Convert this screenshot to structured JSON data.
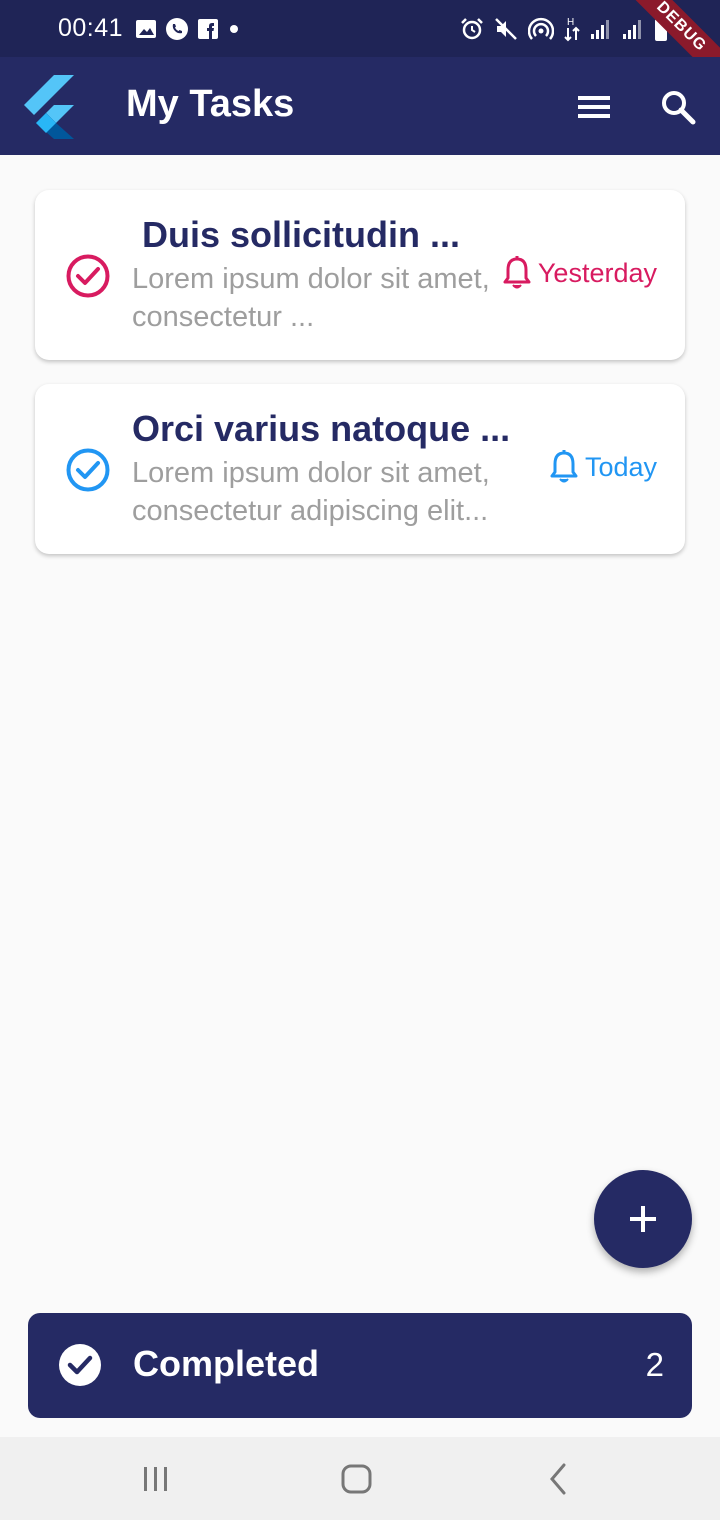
{
  "status_bar": {
    "time": "00:41",
    "left_icons": [
      "image-icon",
      "whatsapp-icon",
      "facebook-icon",
      "dot-icon"
    ],
    "right_icons": [
      "alarm-icon",
      "mute-icon",
      "hotspot-icon",
      "data-arrows-icon",
      "signal-icon",
      "signal-icon",
      "battery-icon"
    ],
    "network_label": "H",
    "debug_banner": "DEBUG"
  },
  "app_bar": {
    "title": "My Tasks",
    "logo": "flutter-logo",
    "actions": [
      "menu-icon",
      "search-icon"
    ]
  },
  "tasks": [
    {
      "title": "Duis sollicitudin ...",
      "description": "Lorem ipsum dolor sit amet, consectetur ...",
      "reminder": "Yesterday",
      "color": "#d81b60",
      "icon": "check-circle-outline-icon"
    },
    {
      "title": "Orci varius natoque ...",
      "description": "Lorem ipsum dolor sit amet, consectetur adipiscing elit...",
      "reminder": "Today",
      "color": "#2196f3",
      "icon": "check-circle-outline-icon"
    }
  ],
  "fab": {
    "icon": "plus-icon"
  },
  "completed": {
    "label": "Completed",
    "count": "2",
    "icon": "check-circle-icon"
  },
  "nav_bar": [
    "recents-icon",
    "home-icon",
    "back-icon"
  ],
  "colors": {
    "primary": "#252a64",
    "status_bar": "#1f2456",
    "overdue": "#d81b60",
    "today": "#2196f3",
    "muted_text": "#9e9e9e",
    "background": "#fafafa"
  }
}
